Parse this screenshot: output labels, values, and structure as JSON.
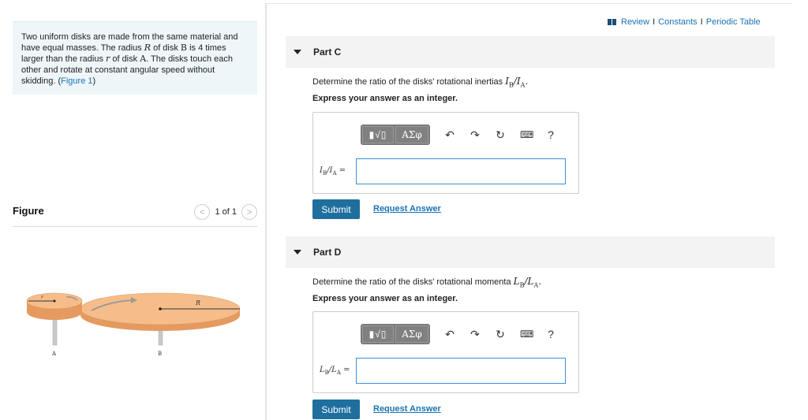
{
  "problem": {
    "text_1": "Two uniform disks are made from the same material and have equal masses. The radius ",
    "sym_R": "R",
    "text_2": " of disk ",
    "sym_B": "B",
    "text_3": " is 4 times larger than the radius ",
    "sym_r": "r",
    "text_4": " of disk ",
    "sym_A": "A",
    "text_5": ". The disks touch each other and rotate at constant angular speed without skidding. (",
    "figure_link": "Figure 1",
    "text_6": ")"
  },
  "figure": {
    "title": "Figure",
    "pager_text": "1 of 1",
    "prev": "<",
    "next": ">",
    "label_r": "r",
    "label_R": "R",
    "label_A": "A",
    "label_B": "B"
  },
  "header": {
    "review": "Review",
    "constants": "Constants",
    "periodic_table": "Periodic Table",
    "separator": "I"
  },
  "parts": [
    {
      "title": "Part C",
      "prompt": "Determine the ratio of the disks' rotational inertias ",
      "prompt_math": "I",
      "prompt_math_rest": "B/IA.",
      "instruction": "Express your answer as an integer.",
      "eq_label": "IB/IA =",
      "answer_value": "",
      "submit": "Submit",
      "request": "Request Answer"
    },
    {
      "title": "Part D",
      "prompt": "Determine the ratio of the disks' rotational momenta ",
      "prompt_math": "L",
      "prompt_math_rest": "B/LA.",
      "instruction": "Express your answer as an integer.",
      "eq_label": "LB/LA =",
      "answer_value": "",
      "submit": "Submit",
      "request": "Request Answer"
    }
  ],
  "toolbar": {
    "templates": "▮√▯",
    "greek": "ΑΣφ",
    "undo": "↶",
    "redo": "↷",
    "reset": "↻",
    "keyboard": "⌨",
    "help": "?"
  },
  "colors": {
    "accent": "#1a73b5",
    "submit_bg": "#1f6f9e",
    "problem_bg": "#eef6fa",
    "disk": "#f2b27e"
  }
}
